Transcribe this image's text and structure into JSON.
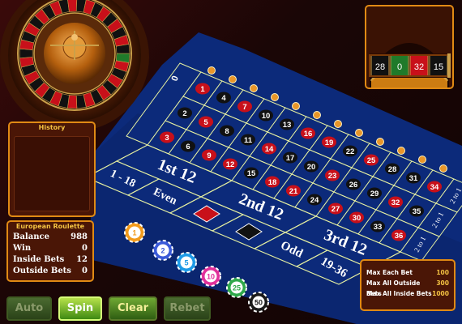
{
  "history": {
    "title": "History"
  },
  "stats": {
    "title": "European Roulette",
    "rows": [
      {
        "label": "Balance",
        "value": "988"
      },
      {
        "label": "Win",
        "value": "0"
      },
      {
        "label": "Inside Bets",
        "value": "12"
      },
      {
        "label": "Outside Bets",
        "value": "0"
      }
    ]
  },
  "limits": {
    "rows": [
      {
        "label": "Max Each Bet",
        "value": "100"
      },
      {
        "label": "Max All Outside Bets",
        "value": "300"
      },
      {
        "label": "Max All Inside Bets",
        "value": "1000"
      }
    ]
  },
  "buttons": {
    "auto": "Auto",
    "spin": "Spin",
    "clear": "Clear",
    "rebet": "Rebet"
  },
  "wheel_result": {
    "numbers": [
      "28",
      "0",
      "32",
      "15"
    ]
  },
  "grid": {
    "zero": "0",
    "rows": [
      [
        "1",
        "2",
        "3"
      ],
      [
        "4",
        "5",
        "6"
      ],
      [
        "7",
        "8",
        "9"
      ],
      [
        "10",
        "11",
        "12"
      ],
      [
        "13",
        "14",
        "15"
      ],
      [
        "16",
        "17",
        "18"
      ],
      [
        "19",
        "20",
        "21"
      ],
      [
        "22",
        "23",
        "24"
      ],
      [
        "25",
        "26",
        "27"
      ],
      [
        "28",
        "29",
        "30"
      ],
      [
        "31",
        "32",
        "33"
      ],
      [
        "34",
        "35",
        "36"
      ]
    ],
    "red": [
      "1",
      "3",
      "5",
      "7",
      "9",
      "12",
      "14",
      "16",
      "18",
      "19",
      "21",
      "23",
      "25",
      "27",
      "30",
      "32",
      "34",
      "36"
    ],
    "columns": [
      "2 to 1",
      "2 to 1",
      "2 to 1"
    ]
  },
  "outside": {
    "dozens": [
      "1st 12",
      "2nd 12",
      "3rd 12"
    ],
    "low": "1 - 18",
    "even": "Even",
    "odd": "Odd",
    "high": "19-36"
  },
  "chips": [
    "1",
    "2",
    "5",
    "10",
    "25",
    "50"
  ],
  "colors": {
    "accent": "#f4c343",
    "felt": "#0c2a7a",
    "red": "#c8101a",
    "black": "#111111",
    "line": "#e6f0a0"
  }
}
